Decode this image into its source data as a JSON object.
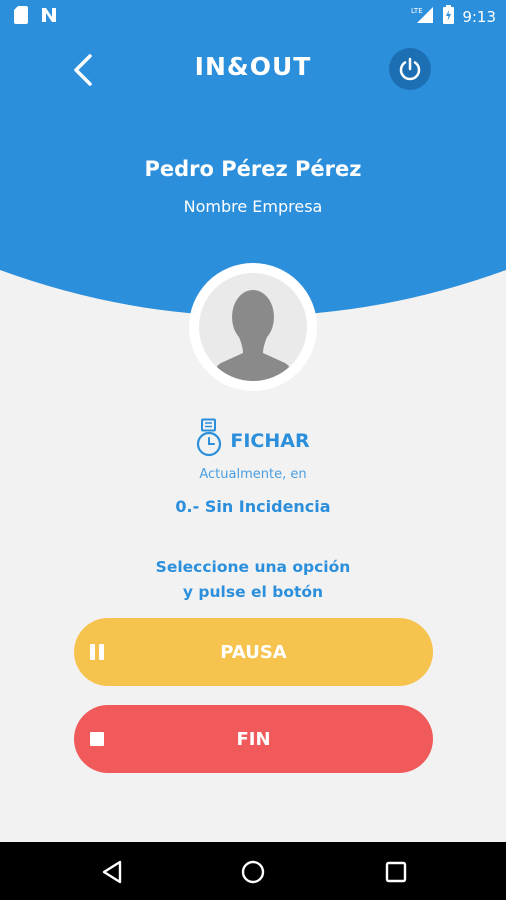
{
  "status_bar": {
    "network_label": "LTE",
    "time": "9:13",
    "icons": [
      "sd-card-icon",
      "n-notification-icon",
      "signal-icon",
      "battery-icon"
    ]
  },
  "header": {
    "logo_text": "IN&OUT",
    "back_icon": "chevron-left-icon",
    "power_icon": "power-icon",
    "user_name": "Pedro Pérez Pérez",
    "company": "Nombre Empresa"
  },
  "status_section": {
    "title": "FICHAR",
    "title_icon": "stopwatch-badge-icon",
    "currently_label": "Actualmente, en",
    "incidence": "0.- Sin Incidencia"
  },
  "instructions": {
    "line1": "Seleccione una opción",
    "line2": "y pulse el botón"
  },
  "buttons": {
    "pause_label": "PAUSA",
    "end_label": "FIN"
  },
  "colors": {
    "primary_blue": "#2b8fdc",
    "dark_blue": "#1c6fb3",
    "pause_yellow": "#f6c34e",
    "end_red": "#f05a5a",
    "background": "#f2f2f2"
  },
  "nav_bar": {
    "icons": [
      "back-triangle-icon",
      "home-circle-icon",
      "recents-square-icon"
    ]
  }
}
